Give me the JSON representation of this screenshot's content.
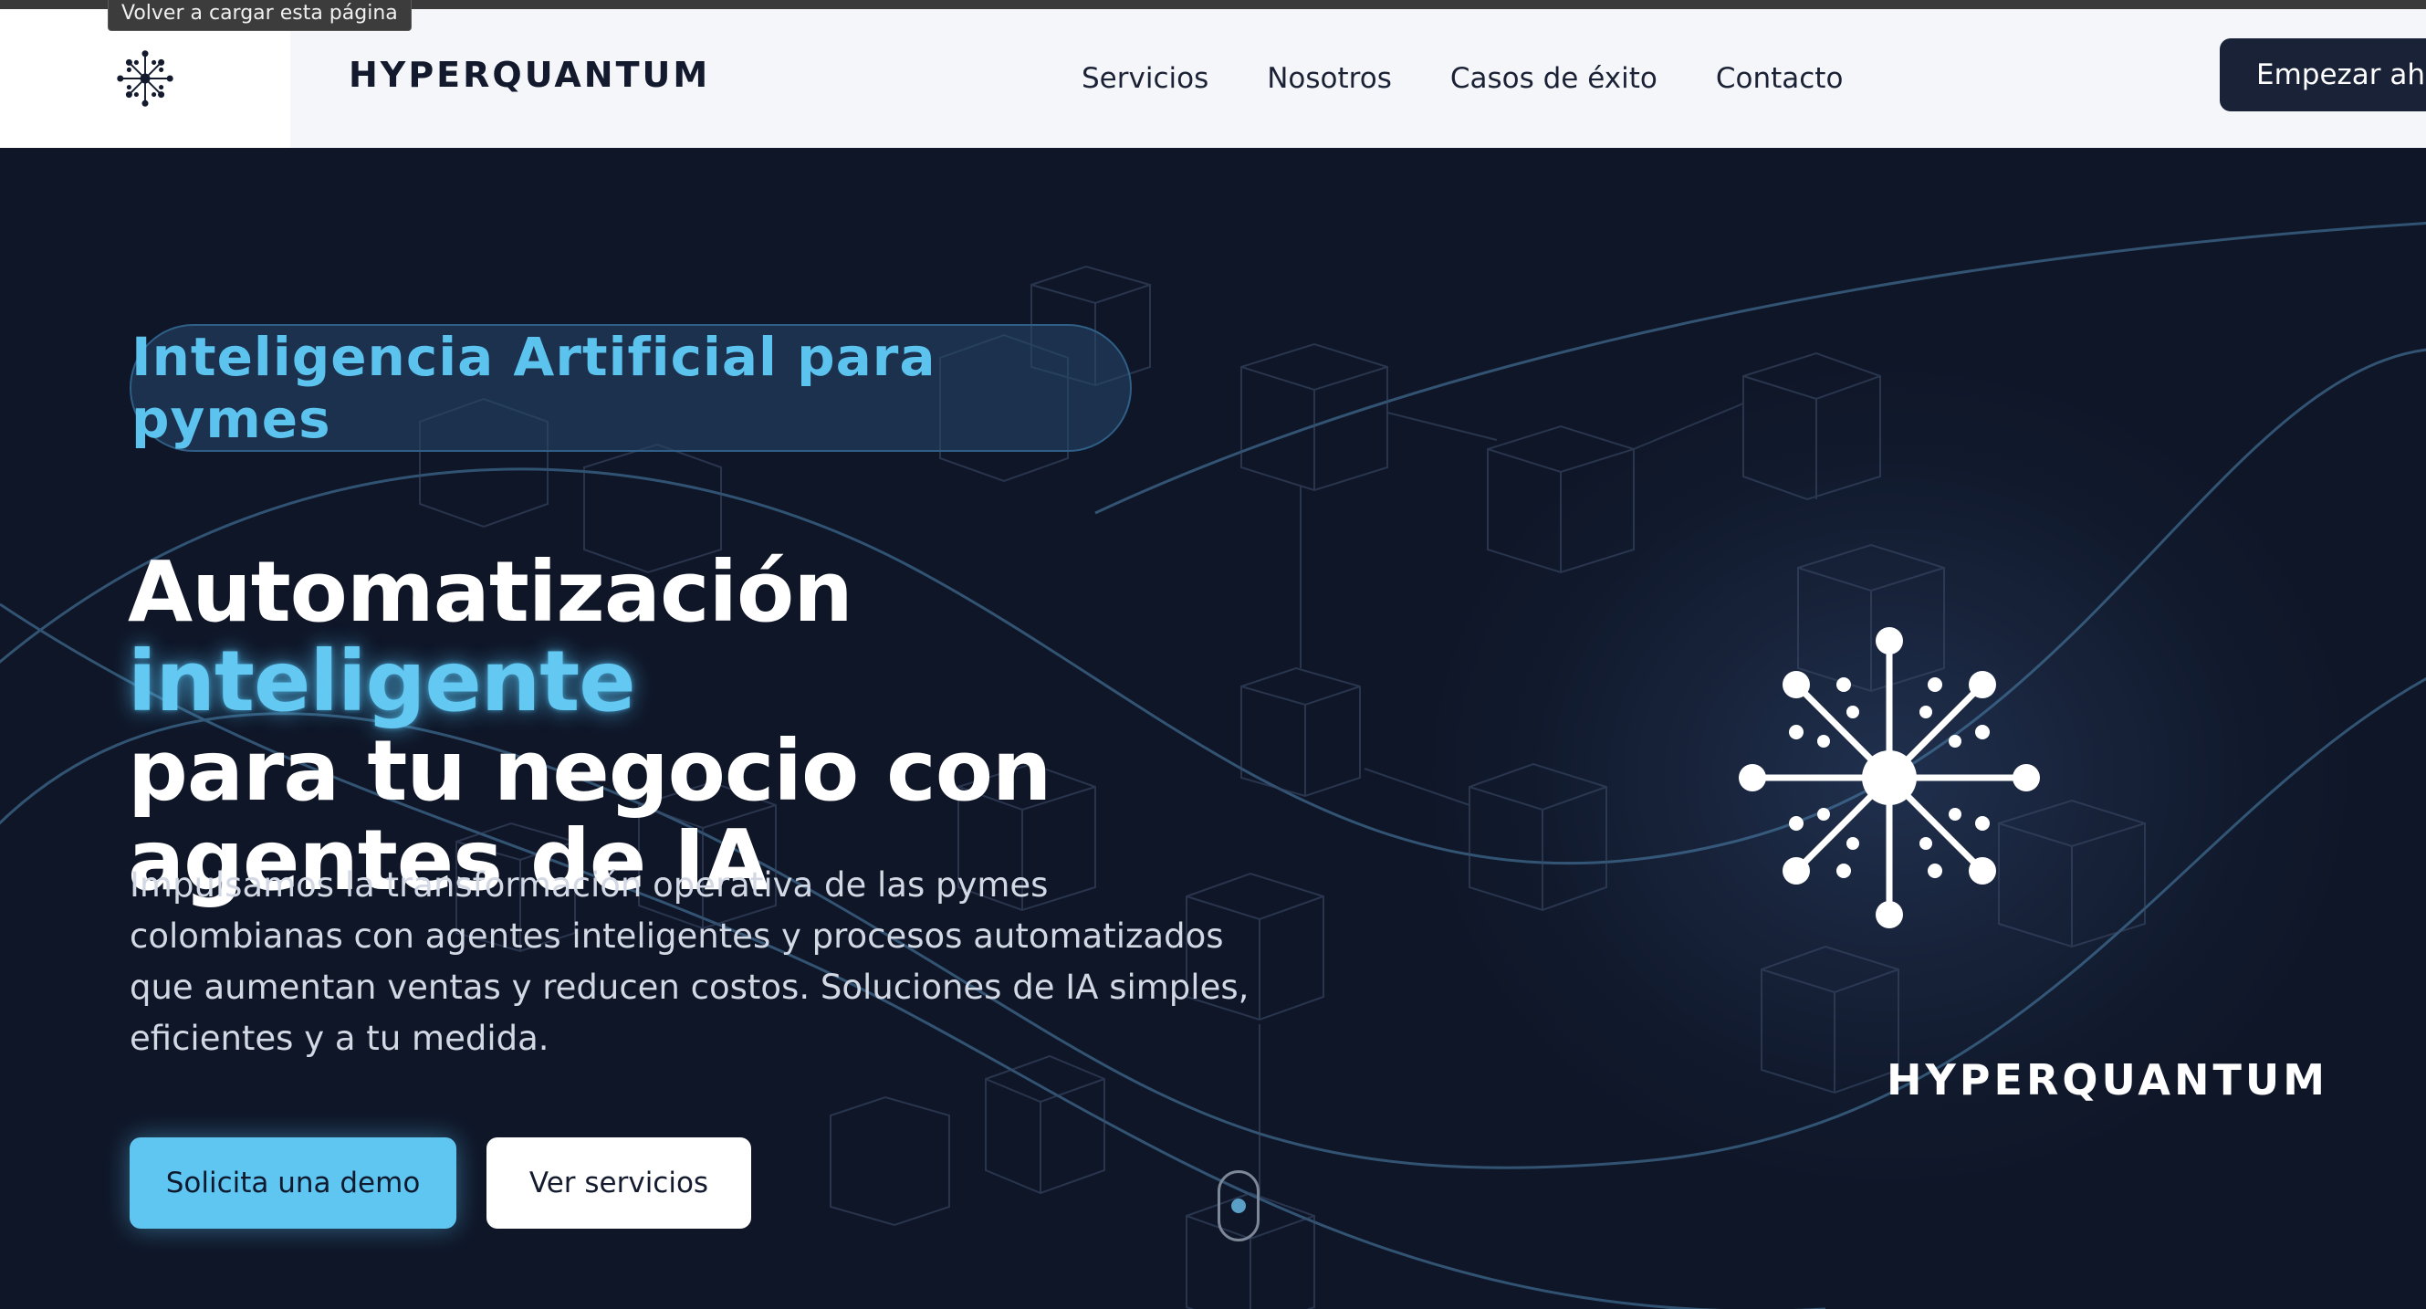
{
  "browser": {
    "tooltip": "Volver a cargar esta página"
  },
  "header": {
    "logo_icon": "hyperquantum-star-icon",
    "brand": "HYPERQUANTUM",
    "nav": [
      {
        "label": "Servicios"
      },
      {
        "label": "Nosotros"
      },
      {
        "label": "Casos de éxito"
      },
      {
        "label": "Contacto"
      }
    ],
    "cta_label": "Empezar ahora"
  },
  "hero": {
    "badge": "Inteligencia Artificial para pymes",
    "headline_part1": "Automatización ",
    "headline_highlight": "inteligente",
    "headline_part2": "para tu negocio con agentes de IA",
    "lead": "Impulsamos la transformación operativa de las pymes colombianas con agentes inteligentes y procesos automatizados que aumentan ventas y reducen costos. Soluciones de IA simples, eficientes y a tu medida.",
    "primary_button": "Solicita una demo",
    "secondary_button": "Ver servicios",
    "logo_icon": "hyperquantum-star-icon",
    "brand": "HYPERQUANTUM"
  },
  "colors": {
    "header_bg": "#f4f6f9",
    "hero_bg": "#111a2d",
    "accent": "#5ec6f1",
    "cta_bg": "#1a2238"
  }
}
